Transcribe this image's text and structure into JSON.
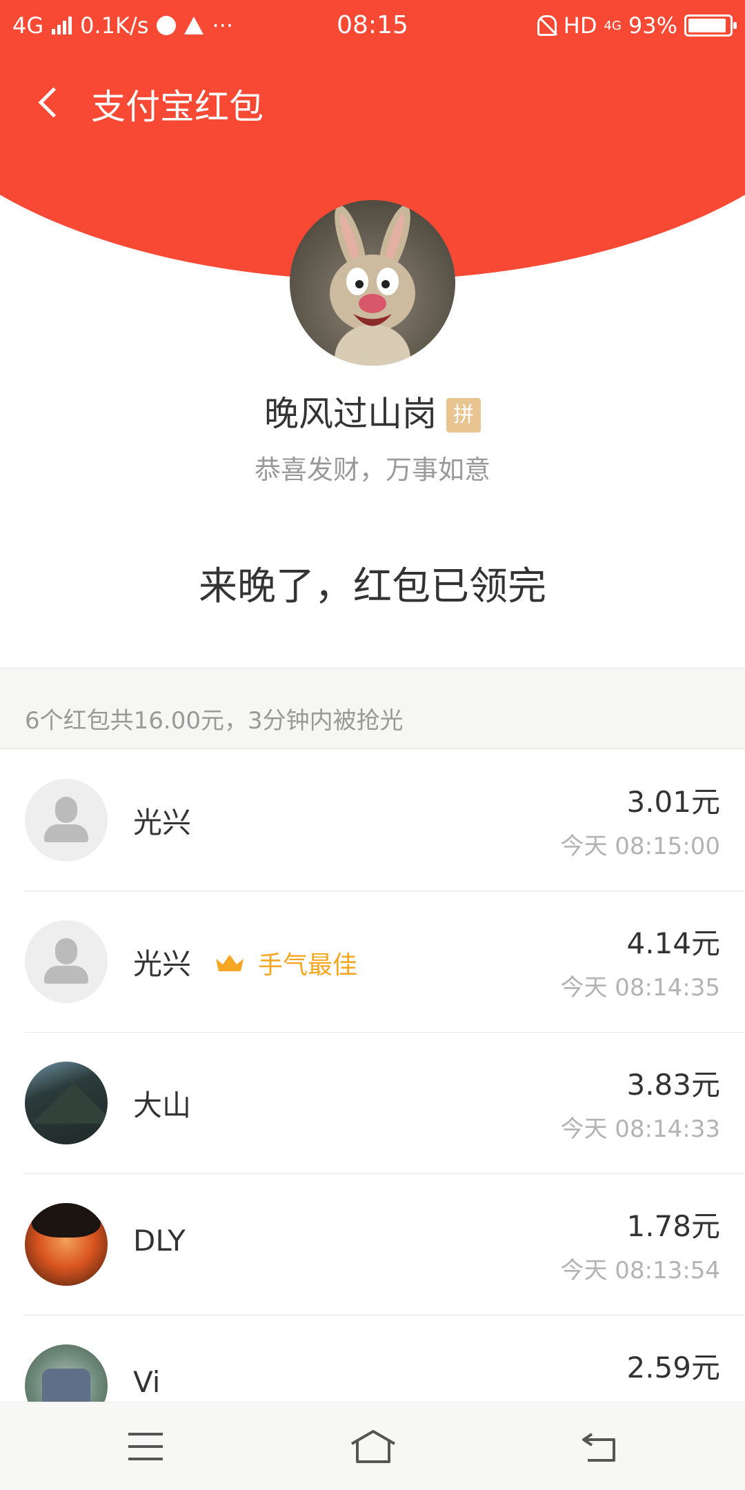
{
  "status_bar": {
    "network": "4G",
    "speed": "0.1K/s",
    "time": "08:15",
    "hd": "HD",
    "net_small": "4G",
    "battery": "93%",
    "battery_level": 0.93
  },
  "nav": {
    "title": "支付宝红包"
  },
  "packet": {
    "sender_name": "晚风过山岗",
    "badge": "拼",
    "blessing": "恭喜发财，万事如意",
    "status_message": "来晚了，红包已领完"
  },
  "summary": "6个红包共16.00元，3分钟内被抢光",
  "recipients": [
    {
      "name": "光兴",
      "amount": "3.01元",
      "time": "今天 08:15:00",
      "avatar": "default-avatar-icon"
    },
    {
      "name": "光兴",
      "amount": "4.14元",
      "time": "今天 08:14:35",
      "avatar": "default-avatar-icon",
      "best_label": "手气最佳"
    },
    {
      "name": "大山",
      "amount": "3.83元",
      "time": "今天 08:14:33",
      "avatar": "mountain-photo"
    },
    {
      "name": "DLY",
      "amount": "1.78元",
      "time": "今天 08:13:54",
      "avatar": "anime-character-photo"
    },
    {
      "name": "Vi",
      "amount": "2.59元",
      "time": "",
      "avatar": "robot-photo"
    }
  ],
  "colors": {
    "header_red": "#f84935",
    "best_orange": "#f5a623",
    "badge_gold": "#e8c590"
  },
  "icons": {
    "back": "chevron-left-icon",
    "crown": "crown-icon",
    "menu": "menu-icon",
    "home": "home-icon",
    "system_back": "return-icon"
  }
}
